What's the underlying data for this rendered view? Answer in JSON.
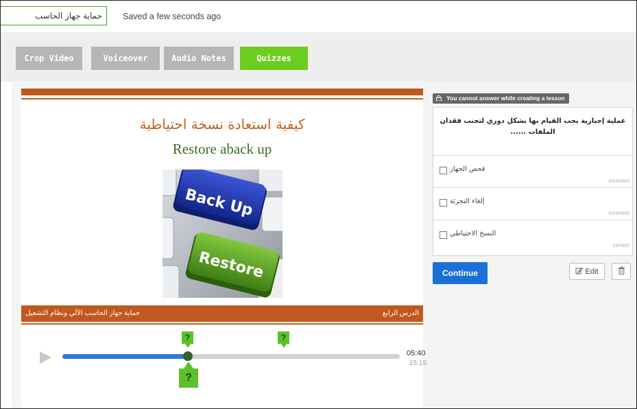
{
  "header": {
    "title_value": "حماية جهاز الحاسب",
    "save_status": "Saved a few seconds ago"
  },
  "toolbar": {
    "buttons": [
      {
        "label": "Crop Video",
        "active": false
      },
      {
        "label": "Voiceover",
        "active": false
      },
      {
        "label": "Audio Notes",
        "active": false
      },
      {
        "label": "Quizzes",
        "active": true
      }
    ]
  },
  "slide": {
    "title_ar": "كيفية استعادة نسخة احتياطية",
    "title_en": "Restore aback up",
    "key_top": "Back Up",
    "key_bottom": "Restore",
    "footer_left": "حماية جهاز الحاسب الآلي ونظام التشغيل",
    "footer_right": "الدرس الرابع"
  },
  "player": {
    "current_time": "05:40",
    "duration": "15:15",
    "progress_fraction": 0.372,
    "marker_symbol": "?"
  },
  "quiz": {
    "notice": "You cannot answer while creating a lesson",
    "question": "عملية إجبارية يجب القيام بها بشكل دوري لتجنب فقدان الملفات ......",
    "answers": [
      {
        "text": "فحص الجهاز",
        "status": "incorrect"
      },
      {
        "text": "إلغاء التجزئة",
        "status": "incorrect"
      },
      {
        "text": "النسخ الاحتياطي",
        "status": "correct"
      }
    ],
    "continue_label": "Continue",
    "edit_label": "Edit"
  },
  "colors": {
    "accent_green": "#6bcd1e",
    "slide_orange": "#c2581e",
    "primary_blue": "#1a70d6"
  }
}
